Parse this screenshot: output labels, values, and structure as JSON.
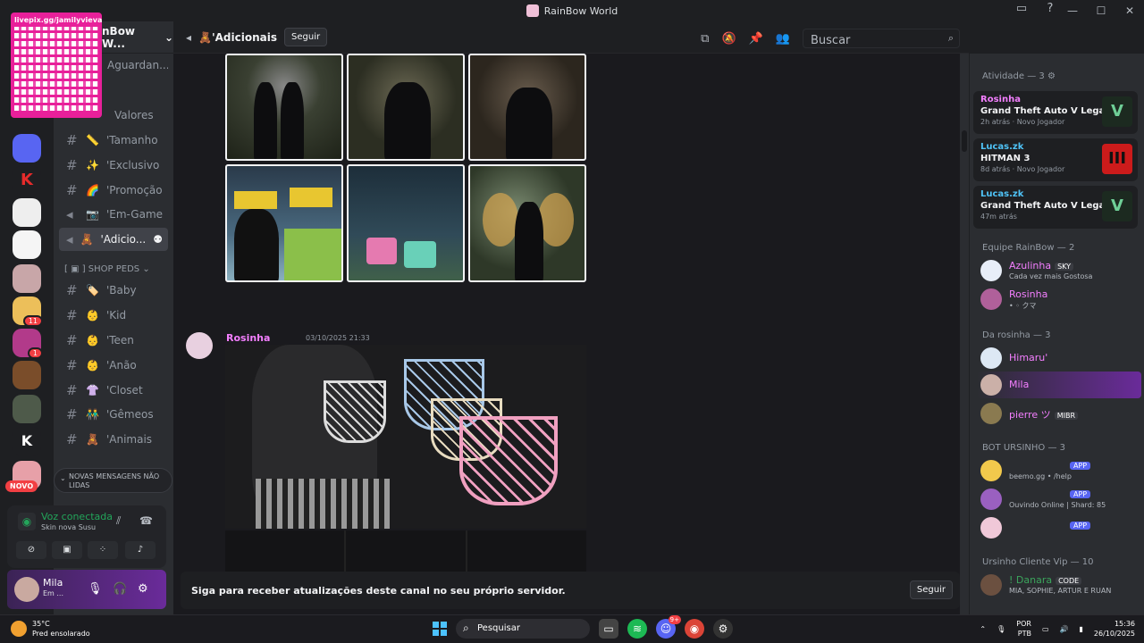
{
  "window": {
    "title": "RainBow World"
  },
  "qr": {
    "label": "livepix.gg/jamilyvieva"
  },
  "server_badges": {
    "novo": "NOVO",
    "count_11": "11",
    "count_1": "1"
  },
  "guild": {
    "name": "nBow W...",
    "pending": "Aguardan..."
  },
  "channels": [
    {
      "name": "Valores",
      "emoji": ""
    },
    {
      "name": "'Tamanho",
      "emoji": "📏"
    },
    {
      "name": "'Exclusivo",
      "emoji": "✨"
    },
    {
      "name": "'Promoção",
      "emoji": "🌈"
    },
    {
      "name": "'Em-Game",
      "emoji": "📷"
    },
    {
      "name": "'Adicio...",
      "emoji": "🧸"
    },
    {
      "name": "'Baby",
      "emoji": "🏷️"
    },
    {
      "name": "'Kid",
      "emoji": "👶"
    },
    {
      "name": "'Teen",
      "emoji": "👶"
    },
    {
      "name": "'Anão",
      "emoji": "👶"
    },
    {
      "name": "'Closet",
      "emoji": "👚"
    },
    {
      "name": "'Gêmeos",
      "emoji": "👬"
    },
    {
      "name": "'Animais",
      "emoji": "🧸"
    }
  ],
  "category_shop": "SHOP PEDS",
  "new_messages": "NOVAS MENSAGENS NÃO LIDAS",
  "voice": {
    "status": "Voz conectada",
    "channel": "Skin nova Susu"
  },
  "user": {
    "name": "Mila",
    "status": "Em ..."
  },
  "channel_header": {
    "name": "🧸'Adicionais",
    "follow": "Seguir",
    "search_placeholder": "Buscar"
  },
  "message": {
    "author": "Rosinha",
    "timestamp": "03/10/2025 21:33"
  },
  "follow_bar": {
    "text": "Siga para receber atualizações deste canal no seu próprio servidor.",
    "button": "Seguir"
  },
  "members": {
    "activity_header": "Atividade — 3",
    "activities": [
      {
        "user": "Rosinha",
        "game": "Grand Theft Auto V Legacy",
        "time": "2h atrás",
        "extra": "Novo Jogador",
        "art": "V",
        "color": "#f47fff"
      },
      {
        "user": "Lucas.zk",
        "game": "HITMAN 3",
        "time": "8d atrás",
        "extra": "Novo Jogador",
        "art": "III",
        "color": "#4fc3f7"
      },
      {
        "user": "Lucas.zk",
        "game": "Grand Theft Auto V Legacy",
        "time": "47m atrás",
        "extra": "",
        "art": "V",
        "color": "#4fc3f7"
      }
    ],
    "team_header": "Equipe RainBow — 2",
    "team": [
      {
        "name": "Azulinha",
        "tag": "SKY",
        "status": "Cada vez mais Gostosa",
        "color": "#f47fff"
      },
      {
        "name": "Rosinha",
        "tag": "",
        "status": "• ◦ クマ",
        "color": "#f47fff"
      }
    ],
    "rosinha_header": "Da rosinha — 3",
    "rosinha": [
      {
        "name": "Himaru'",
        "color": "#f47fff"
      },
      {
        "name": "Mila",
        "color": "#f47fff"
      },
      {
        "name": "pierre ツ",
        "tag": "MIBR",
        "color": "#f47fff"
      }
    ],
    "bot_header": "BOT URSINHO — 3",
    "bots": [
      {
        "status": "beemo.gg • /help",
        "tag": "APP"
      },
      {
        "status": "Ouvindo Online | Shard: 85",
        "tag": "APP"
      },
      {
        "status": "",
        "tag": "APP"
      }
    ],
    "vip_header": "Ursinho Cliente Vip — 10",
    "vip": [
      {
        "name": "! Danara",
        "tag": "CODE",
        "status": "MIA, SOPHIE, ARTUR E RUAN"
      }
    ]
  },
  "taskbar": {
    "temp": "35°C",
    "weather": "Pred ensolarado",
    "search": "Pesquisar",
    "lang1": "POR",
    "lang2": "PTB",
    "time": "15:36",
    "date": "26/10/2025",
    "discord_badge": "9+"
  }
}
